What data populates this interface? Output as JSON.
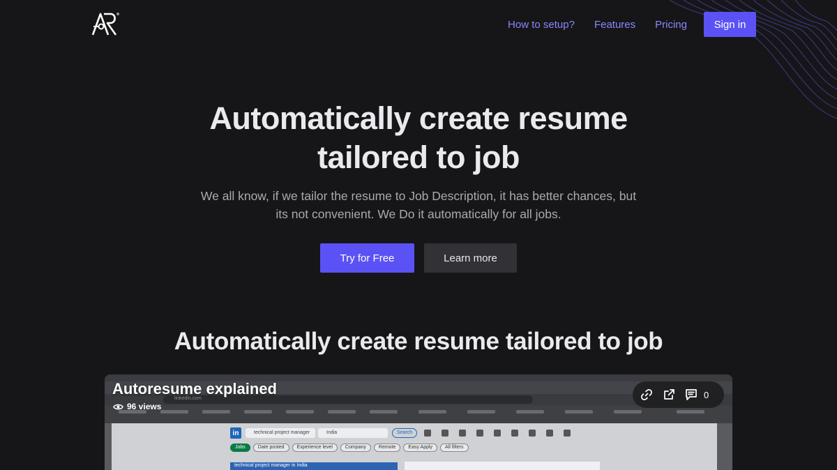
{
  "nav": {
    "links": [
      "How to setup?",
      "Features",
      "Pricing"
    ],
    "signin": "Sign in"
  },
  "hero": {
    "title_line1": "Automatically create resume",
    "title_line2": "tailored to job",
    "sub_line1": "We all know, if we tailor the resume to Job Description, it has better chances, but",
    "sub_line2": "its not convenient. We Do it automatically for all jobs.",
    "primary_cta": "Try for Free",
    "secondary_cta": "Learn more"
  },
  "section": {
    "title": "Automatically create resume tailored to job"
  },
  "video": {
    "title": "Autoresume explained",
    "views": "96 views",
    "comment_count": "0",
    "browser": {
      "url": "linkedin.com",
      "search_value": "technical project manager",
      "location_value": "India",
      "search_button": "Search",
      "filters": [
        "Jobs",
        "Date posted",
        "Experience level",
        "Company",
        "Remote",
        "Easy Apply",
        "All filters"
      ],
      "result_text": "technical project manager in India"
    }
  },
  "colors": {
    "accent": "#5b52f5",
    "link": "#8b86ff",
    "background": "#161618"
  }
}
